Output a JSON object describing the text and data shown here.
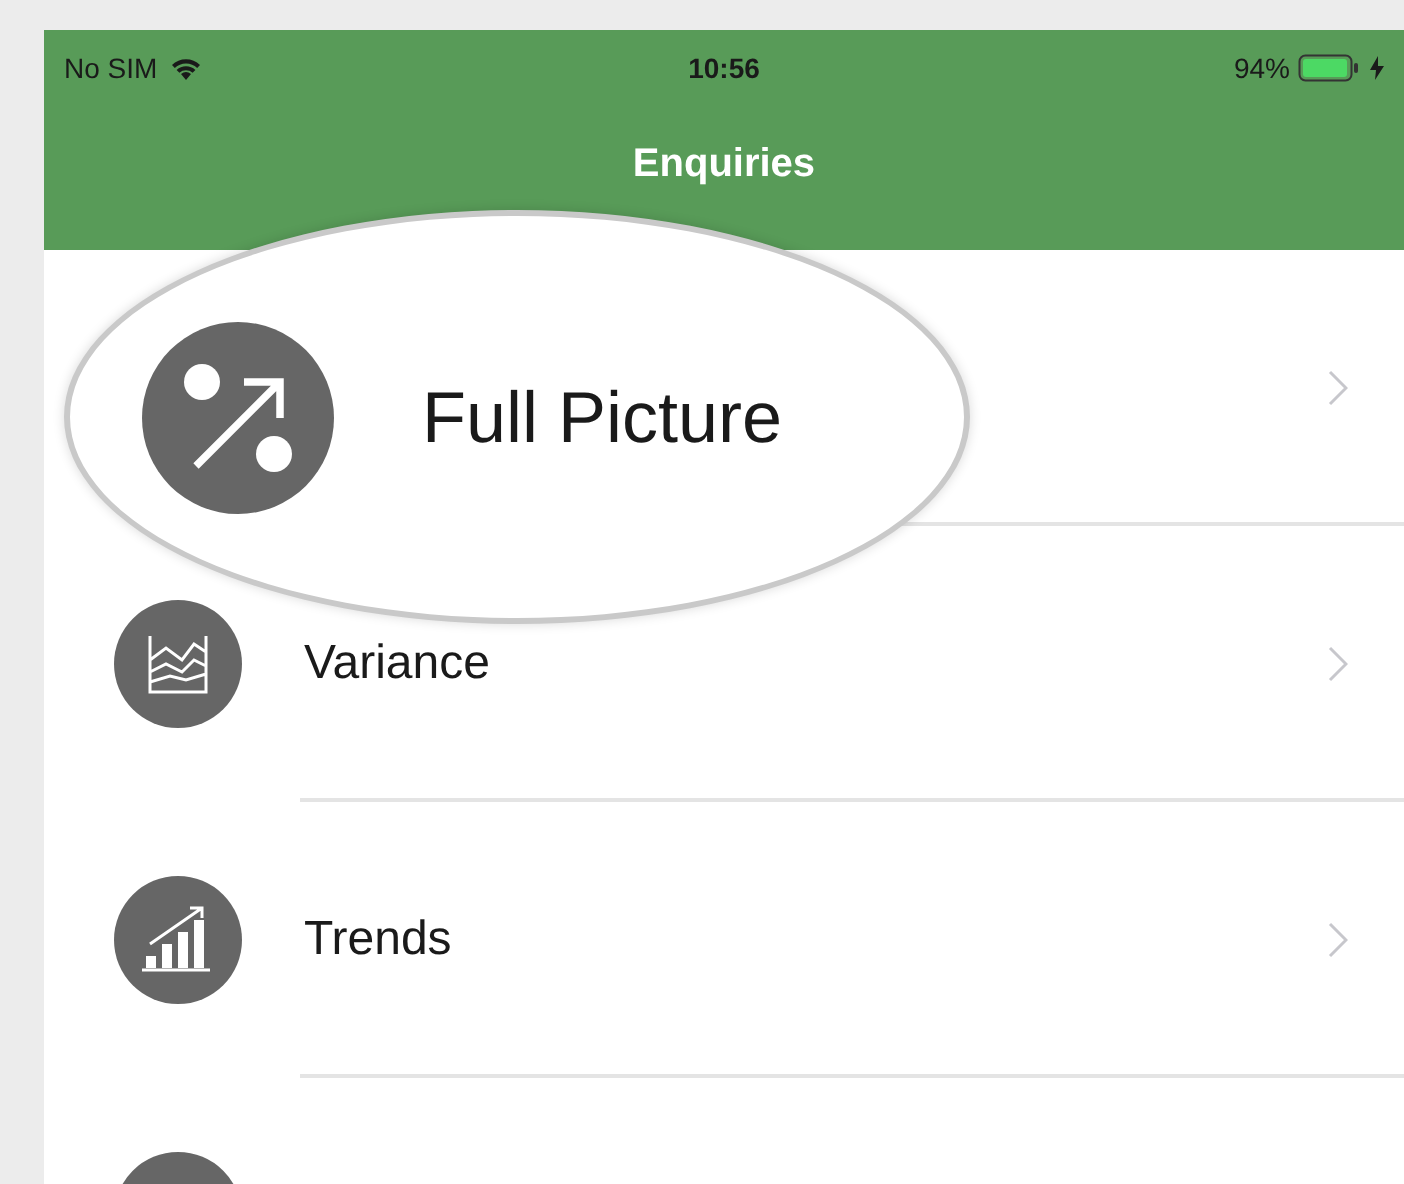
{
  "status_bar": {
    "carrier": "No SIM",
    "time": "10:56",
    "battery": "94%",
    "charging": true
  },
  "nav_bar": {
    "title": "Enquiries"
  },
  "items": [
    {
      "label": "Full Picture",
      "magnified": true
    },
    {
      "label": "Variance",
      "magnified": false
    },
    {
      "label": "Trends",
      "magnified": false
    },
    {
      "magnified": false
    }
  ]
}
